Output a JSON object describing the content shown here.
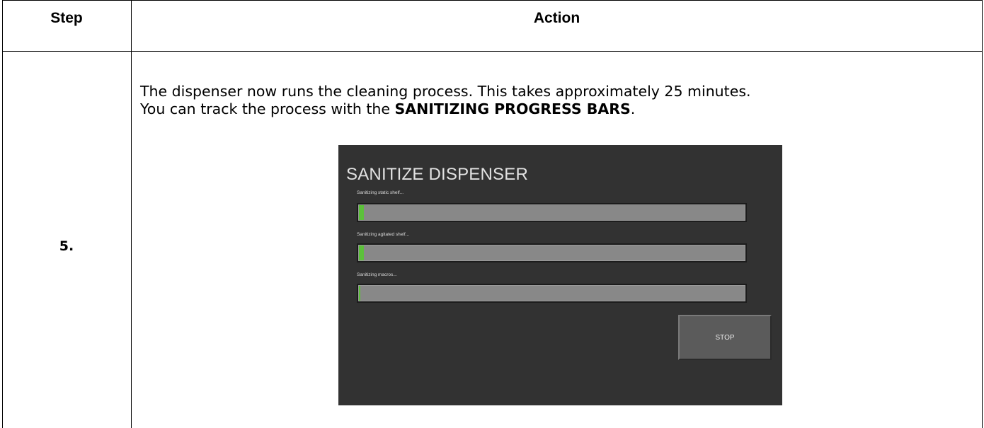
{
  "table": {
    "headers": {
      "step": "Step",
      "action": "Action"
    },
    "row": {
      "step_number": "5.",
      "instruction_line1": "The dispenser now runs the cleaning process.  This takes approximately 25 minutes.",
      "instruction_line2_pre": "You can track the process with the ",
      "instruction_line2_bold": "SANITIZING PROGRESS BARS",
      "instruction_line2_post": "."
    }
  },
  "screen": {
    "title": "SANITIZE DISPENSER",
    "progress_bars": [
      {
        "label": "Sanitizing static shelf...",
        "progress": 0.012
      },
      {
        "label": "Sanitizing agitated shelf...",
        "progress": 0.012
      },
      {
        "label": "Sanitizing macros...",
        "progress": 0.004
      }
    ],
    "stop_label": "STOP",
    "colors": {
      "background": "#323232",
      "bar_track": "#888888",
      "bar_fill": "#5cc03a",
      "button": "#5b5b5b"
    }
  }
}
